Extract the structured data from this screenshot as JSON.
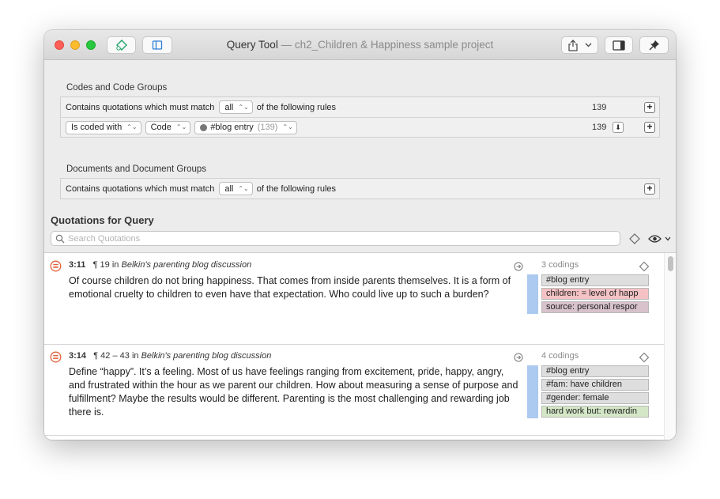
{
  "window": {
    "title": "Query Tool",
    "subtitle": " — ch2_Children & Happiness sample project"
  },
  "codes_section": {
    "label": "Codes and Code Groups",
    "rule_prefix": "Contains quotations which must match",
    "match_mode": "all",
    "rule_suffix": "of the following rules",
    "total_count": "139",
    "condition": {
      "operator": "Is coded with",
      "type": "Code",
      "value": "#blog entry",
      "value_count": "(139)",
      "count": "139"
    }
  },
  "documents_section": {
    "label": "Documents and Document Groups",
    "rule_prefix": "Contains quotations which must match",
    "match_mode": "all",
    "rule_suffix": "of the following rules"
  },
  "quotations": {
    "title": "Quotations for Query",
    "search_placeholder": "Search Quotations",
    "items": [
      {
        "id": "3:11",
        "para": "¶ 19",
        "in": "in",
        "doc": "Belkin's parenting blog discussion",
        "text": "Of course children do not bring happiness. That comes from inside parents themselves. It is a form of emotional cruelty to children to even have that expectation. Who could live up to such a burden?",
        "codings_label": "3 codings",
        "codes": [
          {
            "label": "#blog entry",
            "color": "#dedede"
          },
          {
            "label": "children: = level of happ",
            "color": "#f4c2c4"
          },
          {
            "label": "source: personal respor",
            "color": "#d8c2cc"
          }
        ]
      },
      {
        "id": "3:14",
        "para": "¶ 42 – 43",
        "in": "in",
        "doc": "Belkin's parenting blog discussion",
        "text": "Define “happy”. It’s a feeling. Most of us have feelings ranging from excitement, pride, happy, angry, and frustrated within the hour as we parent our children. How about measuring a sense of purpose and fulfillment? Maybe the results would be different. Parenting is the most challenging and rewarding job there is.",
        "codings_label": "4 codings",
        "codes": [
          {
            "label": "#blog entry",
            "color": "#dedede"
          },
          {
            "label": "#fam: have children",
            "color": "#dedede"
          },
          {
            "label": "#gender: female",
            "color": "#dedede"
          },
          {
            "label": "hard work but: rewardin",
            "color": "#d3e7c7"
          }
        ]
      }
    ]
  }
}
